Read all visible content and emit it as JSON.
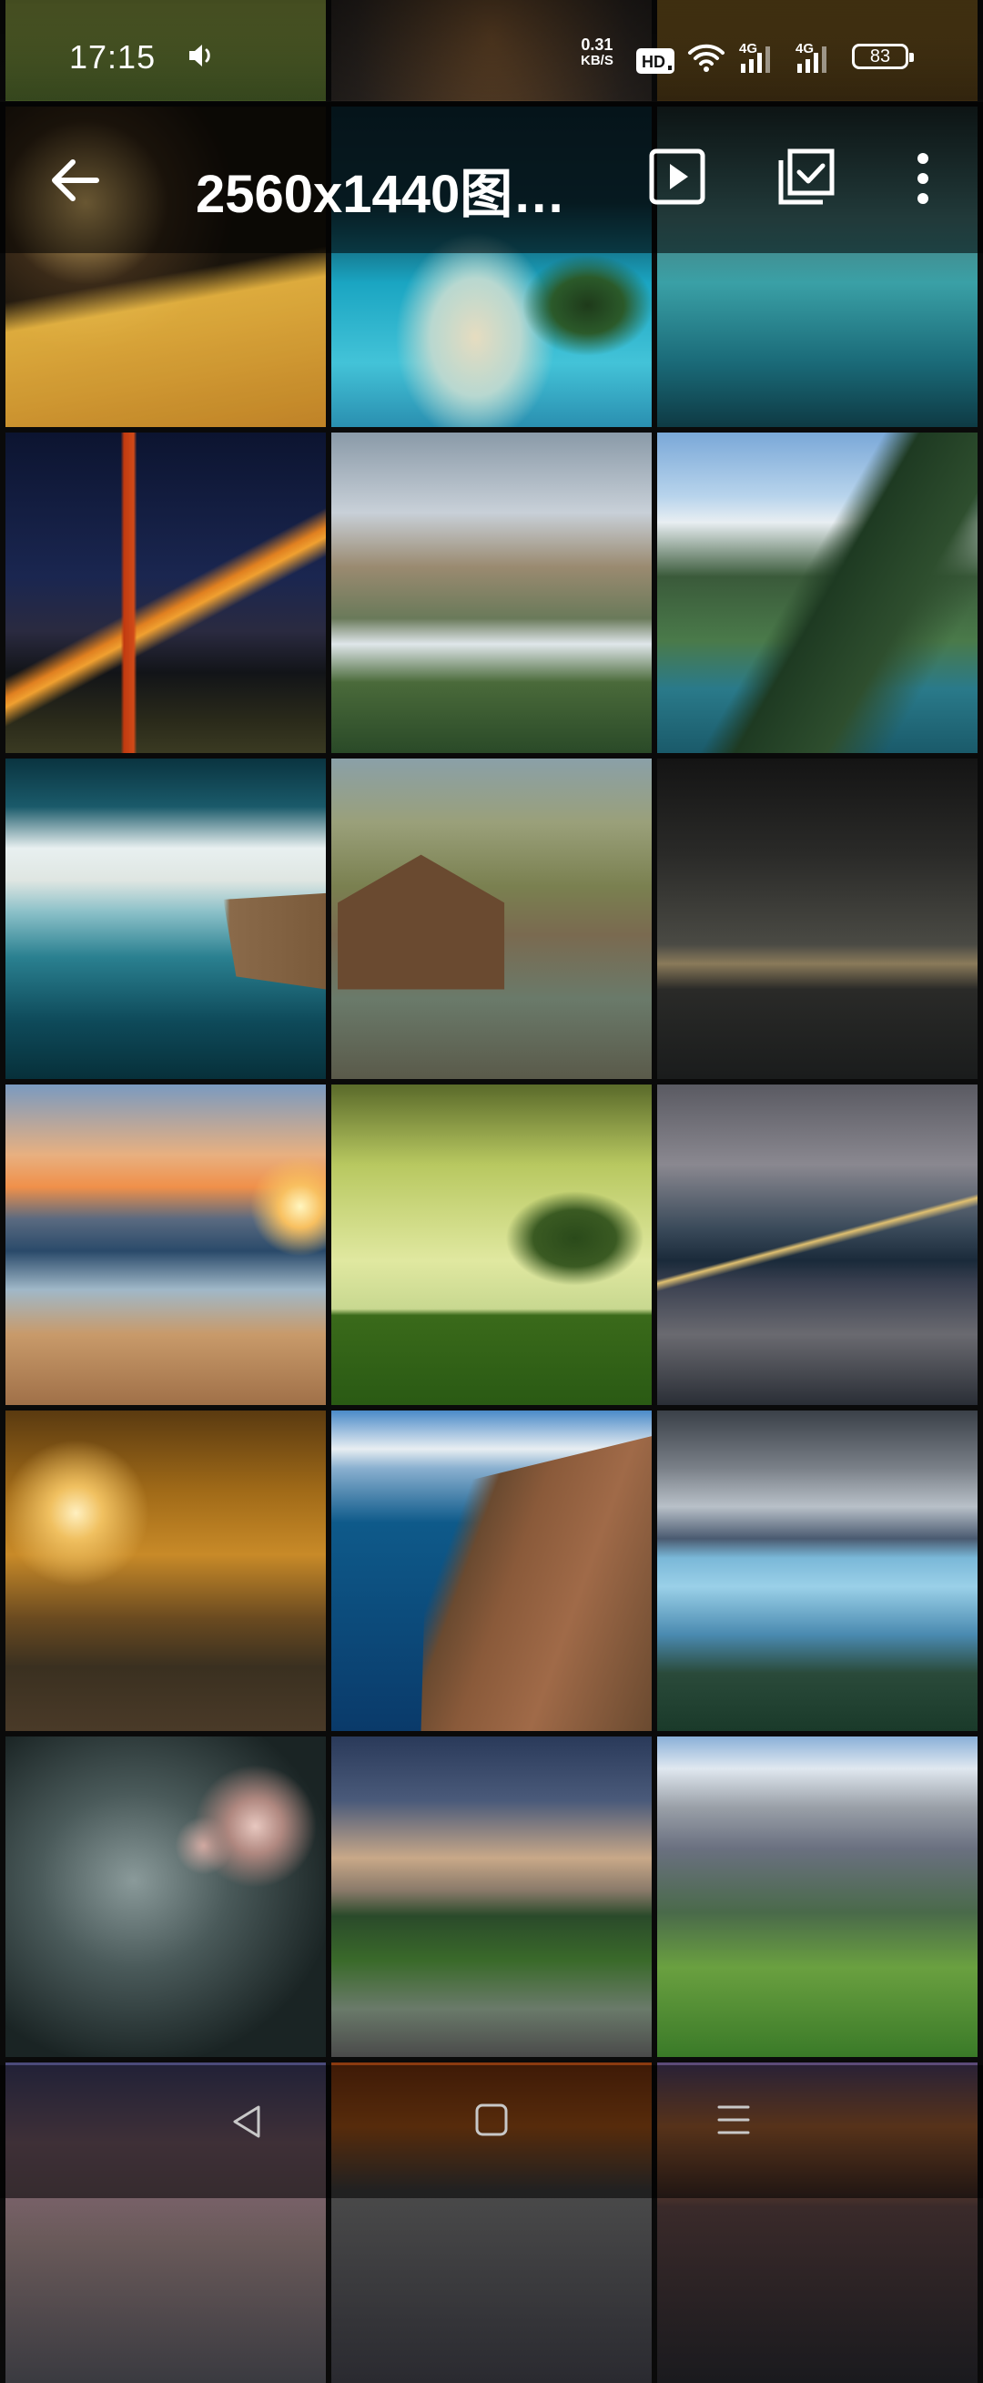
{
  "status_bar": {
    "time": "17:15",
    "net_speed_value": "0.31",
    "net_speed_unit": "KB/S",
    "hd_badge": "HD",
    "signal1_label": "4G",
    "signal2_label": "4G",
    "battery": "83"
  },
  "toolbar": {
    "title": "2560x1440图…"
  },
  "icons": {
    "volume": "volume-icon",
    "wifi": "wifi-icon",
    "back": "back-arrow-icon",
    "slideshow": "play-slideshow-icon",
    "select": "select-check-icon",
    "more": "more-vert-icon",
    "nav_back": "nav-back-icon",
    "nav_home": "nav-home-icon",
    "nav_menu": "nav-menu-icon"
  },
  "gallery": {
    "thumbnails": [
      {
        "subject": "top-partial-1"
      },
      {
        "subject": "top-partial-2"
      },
      {
        "subject": "top-partial-3"
      },
      {
        "subject": "bokeh-lights-golden-ledge"
      },
      {
        "subject": "tropical-island-lagoon"
      },
      {
        "subject": "teal-water-rock"
      },
      {
        "subject": "golden-gate-bridge-night"
      },
      {
        "subject": "yosemite-valley"
      },
      {
        "subject": "norwegian-fjord"
      },
      {
        "subject": "coastal-cliff-seascape"
      },
      {
        "subject": "wooden-boathouse-lake"
      },
      {
        "subject": "city-skyline-dusk"
      },
      {
        "subject": "beach-sunset"
      },
      {
        "subject": "lone-tree-green-field"
      },
      {
        "subject": "brooklyn-bridge-night"
      },
      {
        "subject": "autumn-forest-path"
      },
      {
        "subject": "coastal-cliffs-aerial"
      },
      {
        "subject": "glacier-lake"
      },
      {
        "subject": "cherry-blossom-bokeh"
      },
      {
        "subject": "mountain-road-sunset"
      },
      {
        "subject": "alpine-meadow"
      },
      {
        "subject": "desert-dusk"
      },
      {
        "subject": "autumn-trees"
      },
      {
        "subject": "dark-rock-sunset"
      }
    ]
  }
}
